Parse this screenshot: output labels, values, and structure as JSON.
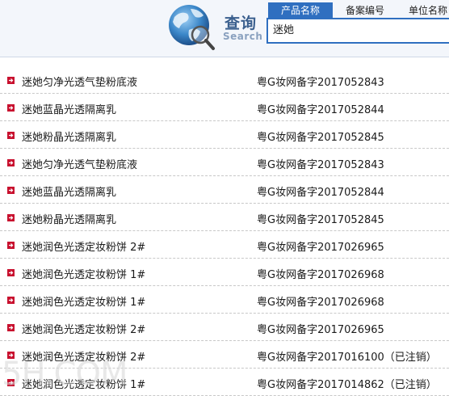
{
  "header": {
    "title": "查询",
    "subtitle": "Search",
    "tabs": [
      {
        "label": "产品名称",
        "active": true
      },
      {
        "label": "备案编号",
        "active": false
      },
      {
        "label": "单位名称",
        "active": false
      }
    ],
    "search": {
      "value": "迷她"
    }
  },
  "results": [
    {
      "name": "迷她匀净光透气垫粉底液",
      "code": "粤G妆网备字2017052843"
    },
    {
      "name": "迷她蓝晶光透隔离乳",
      "code": "粤G妆网备字2017052844"
    },
    {
      "name": "迷她粉晶光透隔离乳",
      "code": "粤G妆网备字2017052845"
    },
    {
      "name": "迷她匀净光透气垫粉底液",
      "code": "粤G妆网备字2017052843"
    },
    {
      "name": "迷她蓝晶光透隔离乳",
      "code": "粤G妆网备字2017052844"
    },
    {
      "name": "迷她粉晶光透隔离乳",
      "code": "粤G妆网备字2017052845"
    },
    {
      "name": "迷她润色光透定妆粉饼 2#",
      "code": "粤G妆网备字2017026965"
    },
    {
      "name": "迷她润色光透定妆粉饼 1#",
      "code": "粤G妆网备字2017026968"
    },
    {
      "name": "迷她润色光透定妆粉饼 1#",
      "code": "粤G妆网备字2017026968"
    },
    {
      "name": "迷她润色光透定妆粉饼 2#",
      "code": "粤G妆网备字2017026965"
    },
    {
      "name": "迷她润色光透定妆粉饼 2#",
      "code": "粤G妆网备字2017016100（已注销）"
    },
    {
      "name": "迷她润色光透定妆粉饼 1#",
      "code": "粤G妆网备字2017014862（已注销）"
    }
  ],
  "watermark": "5H.COM",
  "colors": {
    "accent": "#2f6fc0",
    "bullet": "#c8102e"
  }
}
